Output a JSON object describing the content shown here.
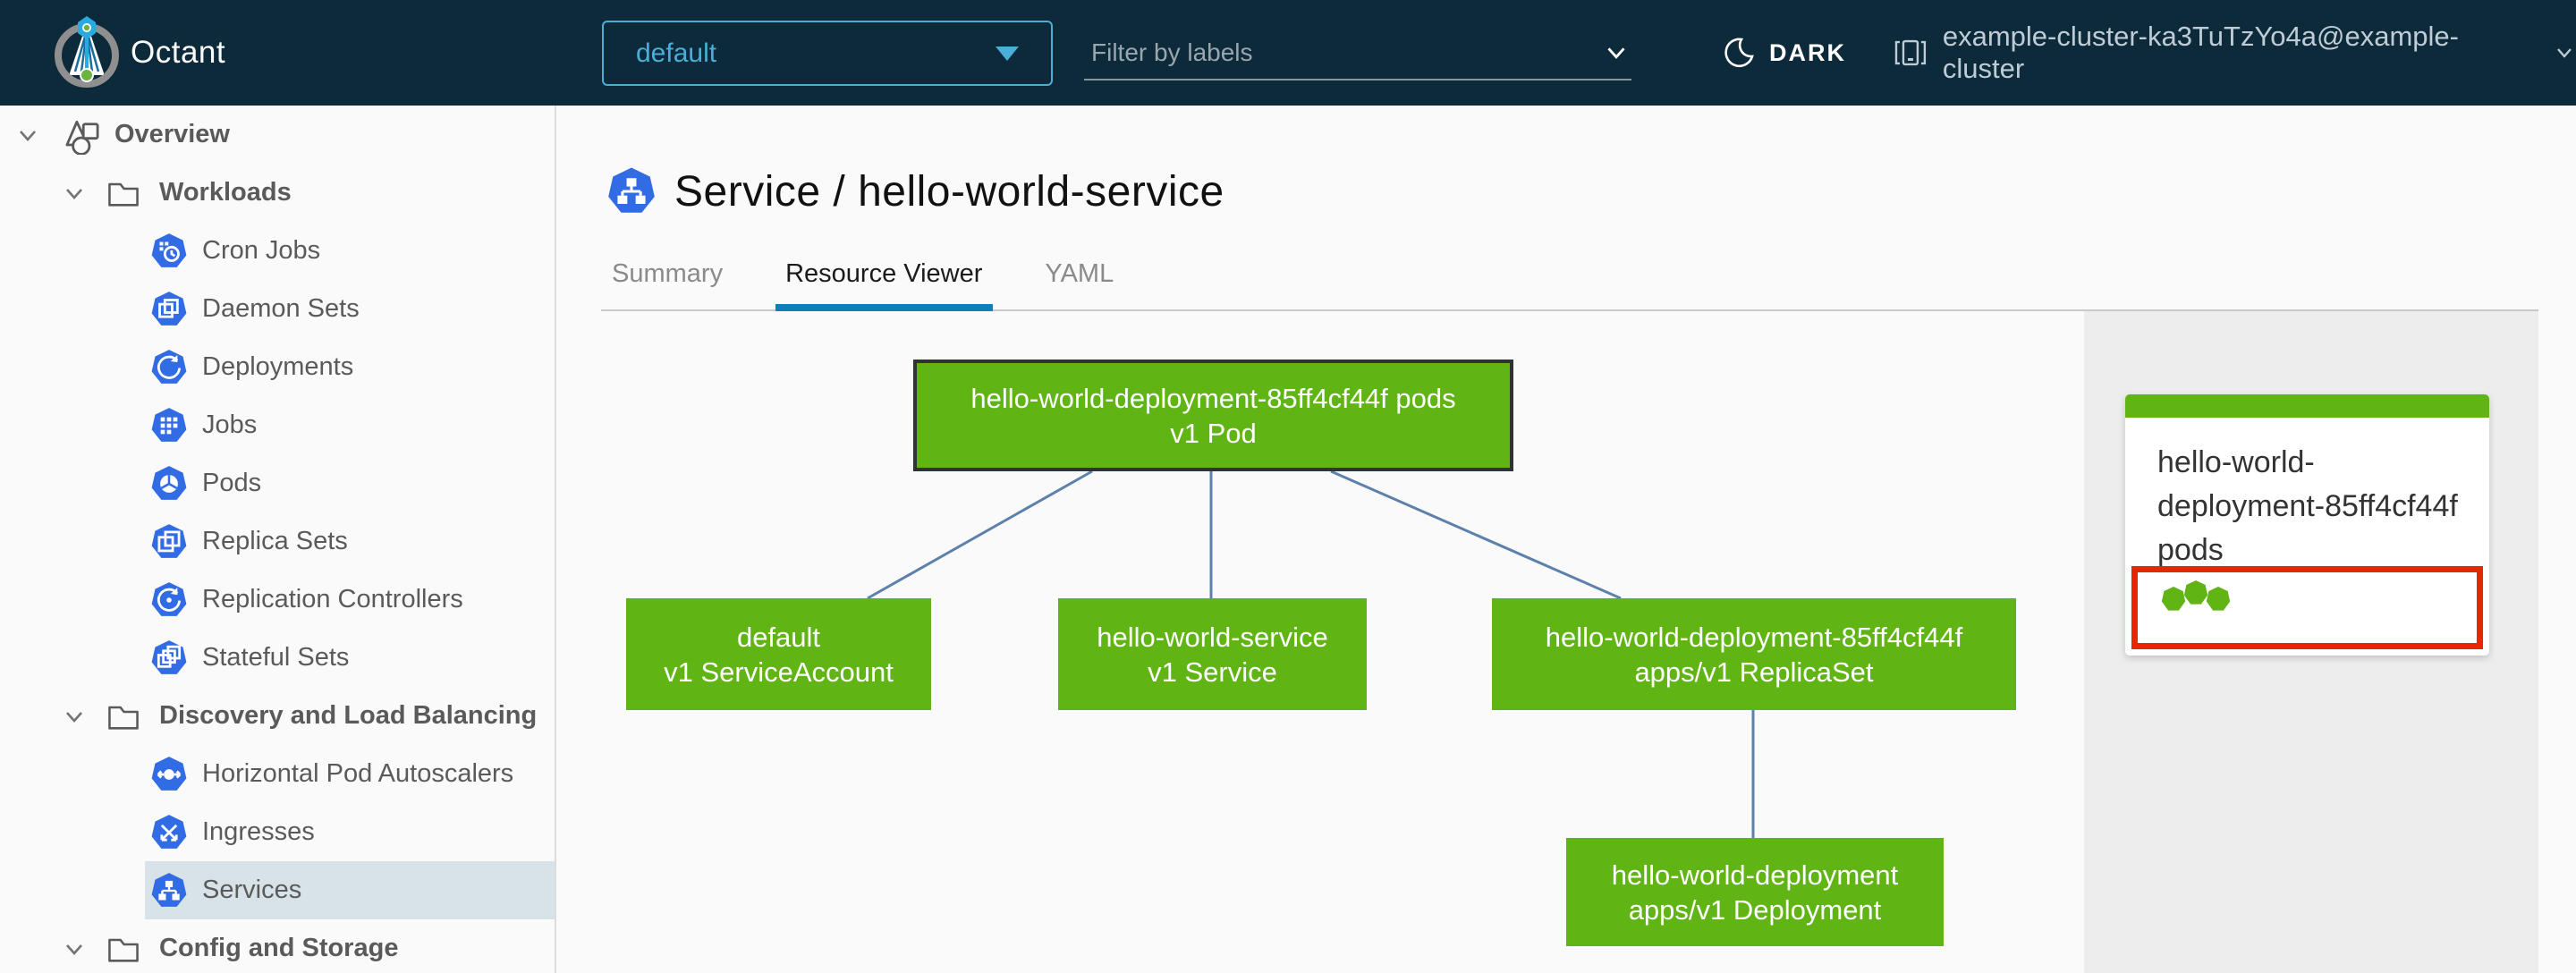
{
  "header": {
    "app_name": "Octant",
    "namespace_selector": {
      "value": "default"
    },
    "filter": {
      "placeholder": "Filter by labels"
    },
    "theme_toggle_label": "DARK",
    "cluster_selector": "example-cluster-ka3TuTzYo4a@example-cluster"
  },
  "sidebar": {
    "items": [
      {
        "label": "Overview",
        "level": 0,
        "icon": "objects",
        "expanded": true
      },
      {
        "label": "Workloads",
        "level": 1,
        "icon": "folder",
        "expanded": true
      },
      {
        "label": "Cron Jobs",
        "level": 2,
        "icon": "cronjob"
      },
      {
        "label": "Daemon Sets",
        "level": 2,
        "icon": "daemonset"
      },
      {
        "label": "Deployments",
        "level": 2,
        "icon": "deployment"
      },
      {
        "label": "Jobs",
        "level": 2,
        "icon": "job"
      },
      {
        "label": "Pods",
        "level": 2,
        "icon": "pod"
      },
      {
        "label": "Replica Sets",
        "level": 2,
        "icon": "replicaset"
      },
      {
        "label": "Replication Controllers",
        "level": 2,
        "icon": "replicationcontroller"
      },
      {
        "label": "Stateful Sets",
        "level": 2,
        "icon": "statefulset"
      },
      {
        "label": "Discovery and Load Balancing",
        "level": 1,
        "icon": "folder",
        "expanded": true
      },
      {
        "label": "Horizontal Pod Autoscalers",
        "level": 2,
        "icon": "hpa"
      },
      {
        "label": "Ingresses",
        "level": 2,
        "icon": "ingress"
      },
      {
        "label": "Services",
        "level": 2,
        "icon": "service",
        "selected": true
      },
      {
        "label": "Config and Storage",
        "level": 1,
        "icon": "folder",
        "expanded": true
      }
    ]
  },
  "content": {
    "title": {
      "kind_icon": "service",
      "text": "Service / hello-world-service"
    },
    "tabs": [
      {
        "label": "Summary",
        "active": false
      },
      {
        "label": "Resource Viewer",
        "active": true
      },
      {
        "label": "YAML",
        "active": false
      }
    ]
  },
  "graph": {
    "nodes": [
      {
        "id": "pods",
        "line1": "hello-world-deployment-85ff4cf44f pods",
        "line2": "v1 Pod",
        "selected": true
      },
      {
        "id": "serviceaccount",
        "line1": "default",
        "line2": "v1 ServiceAccount",
        "selected": false
      },
      {
        "id": "service",
        "line1": "hello-world-service",
        "line2": "v1 Service",
        "selected": false
      },
      {
        "id": "replicaset",
        "line1": "hello-world-deployment-85ff4cf44f",
        "line2": "apps/v1 ReplicaSet",
        "selected": false
      },
      {
        "id": "deployment",
        "line1": "hello-world-deployment",
        "line2": "apps/v1 Deployment",
        "selected": false
      }
    ],
    "edges": [
      [
        "pods",
        "serviceaccount"
      ],
      [
        "pods",
        "service"
      ],
      [
        "pods",
        "replicaset"
      ],
      [
        "replicaset",
        "deployment"
      ]
    ]
  },
  "detail_panel": {
    "card": {
      "title": "hello-world-deployment-85ff4cf44f pods",
      "pod_status_dots": 3
    }
  },
  "colors": {
    "header_bg": "#0d2a3a",
    "accent_blue": "#49afd9",
    "k8s_icon_blue": "#326ce5",
    "node_green": "#60b515",
    "edge_blue": "#5e81ab",
    "selection_red": "#e62700",
    "tab_underline_blue": "#0f7fb8",
    "sidebar_selected_bg": "#d8e3e9"
  }
}
